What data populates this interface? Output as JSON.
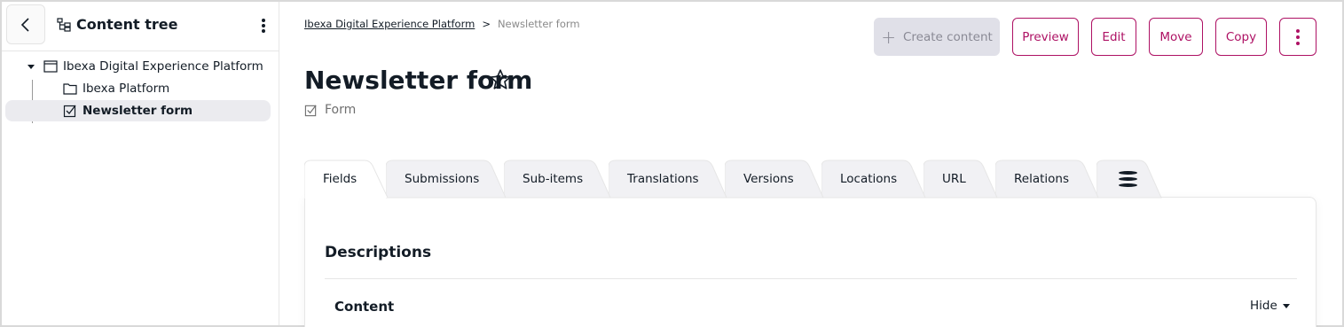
{
  "sidebar": {
    "title": "Content tree",
    "tree": [
      {
        "label": "Ibexa Digital Experience Platform",
        "icon": "folder-open-icon"
      },
      {
        "label": "Ibexa Platform",
        "icon": "folder-icon"
      },
      {
        "label": "Newsletter form",
        "icon": "form-icon"
      }
    ]
  },
  "breadcrumb": {
    "root": "Ibexa Digital Experience Platform",
    "separator": ">",
    "current": "Newsletter form"
  },
  "actions": {
    "create": "Create content",
    "preview": "Preview",
    "edit": "Edit",
    "move": "Move",
    "copy": "Copy"
  },
  "page": {
    "title": "Newsletter form",
    "content_type": "Form"
  },
  "tabs": [
    "Fields",
    "Submissions",
    "Sub-items",
    "Translations",
    "Versions",
    "Locations",
    "URL",
    "Relations"
  ],
  "panel": {
    "section_title": "Descriptions",
    "group_title": "Content",
    "hide_label": "Hide"
  },
  "colors": {
    "accent": "#ae1164",
    "text": "#131c26",
    "selected_bg": "#ebebef",
    "disabled_bg": "#e0e0e8"
  }
}
